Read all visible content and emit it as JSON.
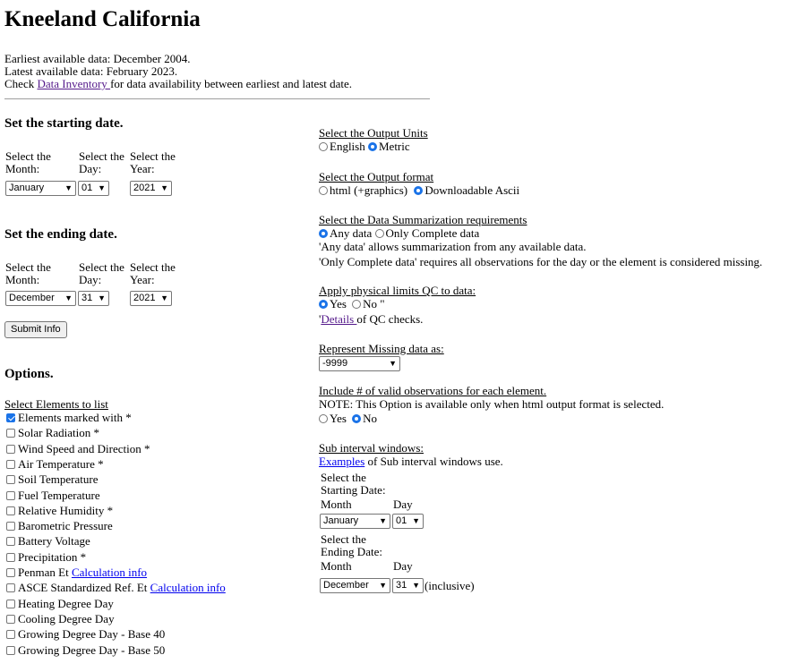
{
  "page": {
    "title": "Kneeland California",
    "earliest": "Earliest available data: December 2004.",
    "latest": "Latest available data: February 2023.",
    "check_prefix": "Check ",
    "inventory_link": "Data Inventory ",
    "check_suffix": "for data availability between earliest and latest date."
  },
  "start": {
    "heading": "Set the starting date.",
    "month_label": [
      "Select the",
      "Month:"
    ],
    "day_label": [
      "Select the",
      "Day:"
    ],
    "year_label": [
      "Select the",
      "Year:"
    ],
    "month": "January",
    "day": "01",
    "year": "2021"
  },
  "end": {
    "heading": "Set the ending date.",
    "month_label": [
      "Select the",
      "Month:"
    ],
    "day_label": [
      "Select the",
      "Day:"
    ],
    "year_label": [
      "Select the",
      "Year:"
    ],
    "month": "December",
    "day": "31",
    "year": "2021"
  },
  "submit_label": "Submit Info",
  "options": {
    "heading": "Options.",
    "elements_label": "Select Elements to list",
    "elements": [
      {
        "label": "Elements marked with *",
        "checked": true
      },
      {
        "label": "Solar Radiation *",
        "checked": false
      },
      {
        "label": "Wind Speed and Direction *",
        "checked": false
      },
      {
        "label": "Air Temperature *",
        "checked": false
      },
      {
        "label": "Soil Temperature",
        "checked": false
      },
      {
        "label": "Fuel Temperature",
        "checked": false
      },
      {
        "label": "Relative Humidity *",
        "checked": false
      },
      {
        "label": "Barometric Pressure",
        "checked": false
      },
      {
        "label": "Battery Voltage",
        "checked": false
      },
      {
        "label": "Precipitation *",
        "checked": false
      },
      {
        "label": "Penman Et ",
        "checked": false,
        "link": "Calculation info"
      },
      {
        "label": "ASCE Standardized Ref. Et ",
        "checked": false,
        "link": "Calculation info"
      },
      {
        "label": "Heating Degree Day",
        "checked": false
      },
      {
        "label": "Cooling Degree Day",
        "checked": false
      },
      {
        "label": "Growing Degree Day - Base 40",
        "checked": false
      },
      {
        "label": "Growing Degree Day - Base 50",
        "checked": false
      }
    ]
  },
  "units": {
    "label": "Select the Output Units",
    "options": [
      "English",
      "Metric"
    ],
    "selected": "Metric"
  },
  "format": {
    "label": "Select the Output format",
    "options": [
      "html (+graphics)",
      "Downloadable Ascii"
    ],
    "selected": "Downloadable Ascii"
  },
  "summarization": {
    "label": "Select the Data Summarization requirements",
    "options": [
      "Any data",
      "Only Complete data"
    ],
    "selected": "Any data",
    "note1": "'Any data' allows summarization from any available data.",
    "note2": "'Only Complete data' requires all observations for the day or the element is considered missing."
  },
  "qc": {
    "label": "Apply physical limits QC to data:",
    "options": [
      "Yes",
      "No \""
    ],
    "selected": "Yes",
    "details_prefix": "'",
    "details_link": "Details ",
    "details_suffix": "of QC checks."
  },
  "missing": {
    "label": "Represent Missing data as:",
    "value": "-9999"
  },
  "valid_obs": {
    "label": "Include # of valid observations for each element.",
    "note": "NOTE: This Option is available only when html output format is selected.",
    "options": [
      "Yes",
      "No"
    ],
    "selected": "No"
  },
  "sub_interval": {
    "label": "Sub interval windows:",
    "examples_link": "Examples",
    "examples_suffix": " of Sub interval windows use.",
    "start_lines": [
      "Select the",
      "Starting Date:"
    ],
    "end_lines": [
      "Select the",
      "Ending Date:"
    ],
    "month_hdr": "Month",
    "day_hdr": "Day",
    "start_month": "January",
    "start_day": "01",
    "end_month": "December",
    "end_day": "31",
    "inclusive": "(inclusive)"
  }
}
